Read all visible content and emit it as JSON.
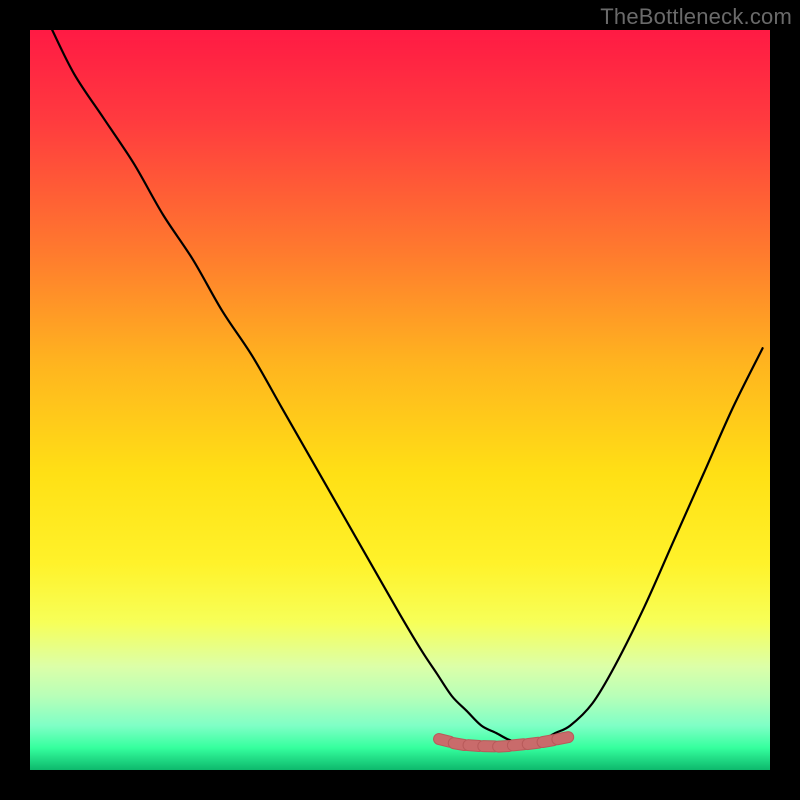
{
  "watermark": "TheBottleneck.com",
  "colors": {
    "frame": "#000000",
    "gradient_stops": [
      {
        "offset": 0.0,
        "color": "#ff1a44"
      },
      {
        "offset": 0.12,
        "color": "#ff3a3f"
      },
      {
        "offset": 0.3,
        "color": "#ff7a2e"
      },
      {
        "offset": 0.45,
        "color": "#ffb41f"
      },
      {
        "offset": 0.6,
        "color": "#ffe015"
      },
      {
        "offset": 0.72,
        "color": "#fff22a"
      },
      {
        "offset": 0.8,
        "color": "#f7ff58"
      },
      {
        "offset": 0.86,
        "color": "#dcffa8"
      },
      {
        "offset": 0.9,
        "color": "#b8ffb8"
      },
      {
        "offset": 0.94,
        "color": "#7fffc6"
      },
      {
        "offset": 0.97,
        "color": "#35ff9e"
      },
      {
        "offset": 1.0,
        "color": "#0db86c"
      }
    ],
    "curve": "#000000",
    "marker_fill": "#c96b6b",
    "marker_stroke": "#b85a5a"
  },
  "chart_data": {
    "type": "line",
    "title": "",
    "xlabel": "",
    "ylabel": "",
    "xlim": [
      0,
      100
    ],
    "ylim": [
      0,
      100
    ],
    "x": [
      3,
      6,
      10,
      14,
      18,
      22,
      26,
      30,
      34,
      38,
      42,
      46,
      50,
      53,
      55,
      57,
      59,
      61,
      63,
      65,
      67,
      69,
      71,
      73,
      76,
      79,
      83,
      87,
      91,
      95,
      99
    ],
    "values": [
      100,
      94,
      88,
      82,
      75,
      69,
      62,
      56,
      49,
      42,
      35,
      28,
      21,
      16,
      13,
      10,
      8,
      6,
      5,
      4,
      4,
      4,
      5,
      6,
      9,
      14,
      22,
      31,
      40,
      49,
      57
    ],
    "markers": {
      "x": [
        56,
        58,
        60,
        62,
        64,
        66,
        68,
        70,
        72
      ],
      "y": [
        4.0,
        3.5,
        3.3,
        3.2,
        3.2,
        3.4,
        3.6,
        3.9,
        4.3
      ]
    }
  }
}
